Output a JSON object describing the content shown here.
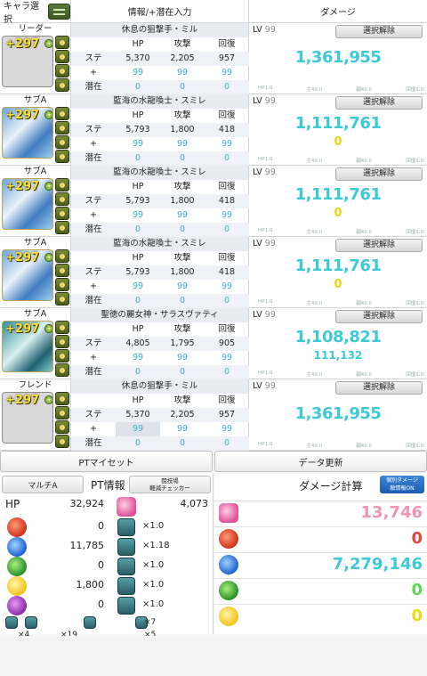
{
  "header": {
    "chara_select": "キャラ選択",
    "info": "情報/+潜在入力",
    "damage": "ダメージ"
  },
  "common": {
    "hp": "HP",
    "atk": "攻撃",
    "rcv": "回復",
    "stat": "ステ",
    "plus": "+",
    "latent": "潜在",
    "lv_label": "LV",
    "deselect": "選択解除",
    "plus297": "+297",
    "mult_hp": "HP1.0",
    "mult_main": "主49.0",
    "mult_sub": "副49.0",
    "mult_rcv": "回復1.0"
  },
  "members": [
    {
      "role": "リーダー",
      "name": "休息の狙撃手・ミル",
      "stat": [
        "5,370",
        "2,205",
        "957"
      ],
      "plus": [
        "99",
        "99",
        "99"
      ],
      "latent": [
        "0",
        "0",
        "0"
      ],
      "lv": "99",
      "damage": "1,361,955",
      "sub": ""
    },
    {
      "role": "サブA",
      "name": "藍海の水龍喚士・スミレ",
      "stat": [
        "5,793",
        "1,800",
        "418"
      ],
      "plus": [
        "99",
        "99",
        "99"
      ],
      "latent": [
        "0",
        "0",
        "0"
      ],
      "lv": "99",
      "damage": "1,111,761",
      "sub": "0"
    },
    {
      "role": "サブA",
      "name": "藍海の水龍喚士・スミレ",
      "stat": [
        "5,793",
        "1,800",
        "418"
      ],
      "plus": [
        "99",
        "99",
        "99"
      ],
      "latent": [
        "0",
        "0",
        "0"
      ],
      "lv": "99",
      "damage": "1,111,761",
      "sub": "0"
    },
    {
      "role": "サブA",
      "name": "藍海の水龍喚士・スミレ",
      "stat": [
        "5,793",
        "1,800",
        "418"
      ],
      "plus": [
        "99",
        "99",
        "99"
      ],
      "latent": [
        "0",
        "0",
        "0"
      ],
      "lv": "99",
      "damage": "1,111,761",
      "sub": "0"
    },
    {
      "role": "サブA",
      "name": "聖徳の麗女神・サラスヴァティ",
      "stat": [
        "4,805",
        "1,795",
        "905"
      ],
      "plus": [
        "99",
        "99",
        "99"
      ],
      "latent": [
        "0",
        "0",
        "0"
      ],
      "lv": "99",
      "damage": "1,108,821",
      "sub": "111,132"
    },
    {
      "role": "フレンド",
      "name": "休息の狙撃手・ミル",
      "stat": [
        "5,370",
        "2,205",
        "957"
      ],
      "plus": [
        "99",
        "99",
        "99"
      ],
      "latent": [
        "0",
        "0",
        "0"
      ],
      "lv": "99",
      "damage": "1,361,955",
      "sub": ""
    }
  ],
  "buttons": {
    "pt_myset": "PTマイセット",
    "data_update": "データ更新"
  },
  "pt_info": {
    "multi": "マルチA",
    "title": "PT情報",
    "checker_line1": "闘技場",
    "checker_line2": "軽減チェッカー",
    "hp_label": "HP",
    "hp": "32,924",
    "rcv": "4,073",
    "attrs": [
      {
        "orb": "fire",
        "value": "0",
        "mult": "×1.0"
      },
      {
        "orb": "water",
        "value": "11,785",
        "mult": "×1.18"
      },
      {
        "orb": "wood",
        "value": "0",
        "mult": "×1.0"
      },
      {
        "orb": "light",
        "value": "1,800",
        "mult": "×1.0"
      },
      {
        "orb": "dark",
        "value": "0",
        "mult": "×1.0"
      }
    ],
    "awk_count1": "×7",
    "awk_count2": "×4",
    "awk_count3": "×19",
    "awk_count4": "×5"
  },
  "damage_calc": {
    "title": "ダメージ計算",
    "detail_line1": "個別ダメージ",
    "detail_line2": "敵情報ON",
    "rows": [
      {
        "kind": "heart",
        "value": "13,746",
        "color": "#ee94b4"
      },
      {
        "kind": "fire",
        "value": "0",
        "color": "#e2473a"
      },
      {
        "kind": "water",
        "value": "7,279,146",
        "color": "#3ec9d6"
      },
      {
        "kind": "wood",
        "value": "0",
        "color": "#5fd45a"
      },
      {
        "kind": "light",
        "value": "0",
        "color": "#e9da12"
      }
    ]
  }
}
